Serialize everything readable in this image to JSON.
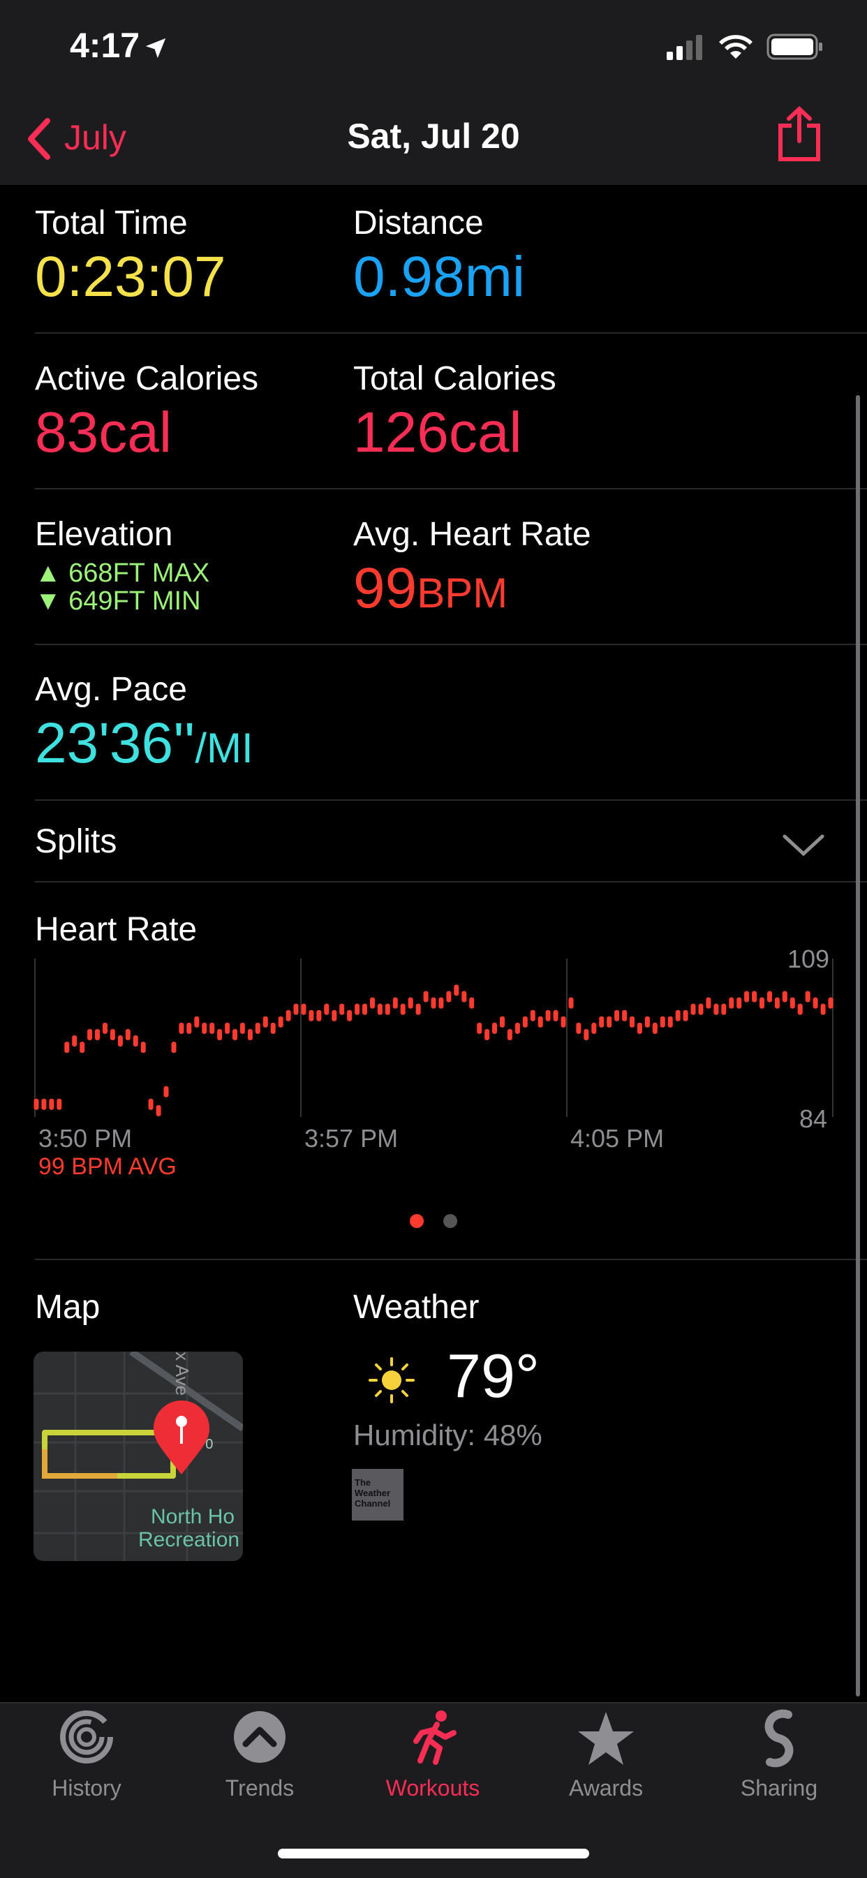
{
  "status": {
    "time": "4:17"
  },
  "nav": {
    "back_label": "July",
    "title": "Sat, Jul 20"
  },
  "metrics": {
    "total_time": {
      "label": "Total Time",
      "value": "0:23:07"
    },
    "distance": {
      "label": "Distance",
      "value": "0.98mi"
    },
    "active_calories": {
      "label": "Active Calories",
      "value": "83cal"
    },
    "total_calories": {
      "label": "Total Calories",
      "value": "126cal"
    },
    "elevation": {
      "label": "Elevation",
      "max": "▲ 668FT MAX",
      "min": "▼ 649FT MIN"
    },
    "avg_heart_rate": {
      "label": "Avg. Heart Rate",
      "value": "99",
      "unit": "BPM"
    },
    "avg_pace": {
      "label": "Avg. Pace",
      "value": "23'36''",
      "unit": "/MI"
    }
  },
  "splits": {
    "label": "Splits"
  },
  "heart_rate": {
    "label": "Heart Rate",
    "y_max_label": "109",
    "y_min_label": "84",
    "x_labels": [
      "3:50 PM",
      "3:57 PM",
      "4:05 PM"
    ],
    "avg_label": "99 BPM AVG"
  },
  "chart_data": {
    "type": "scatter",
    "title": "Heart Rate",
    "ylim": [
      84,
      109
    ],
    "x_tick_labels": [
      "3:50 PM",
      "3:57 PM",
      "4:05 PM"
    ],
    "series": [
      {
        "values": [
          86,
          86,
          86,
          86,
          95,
          96,
          95,
          97,
          97,
          98,
          97,
          96,
          97,
          96,
          95,
          86,
          85,
          88,
          95,
          98,
          98,
          99,
          98,
          98,
          97,
          98,
          97,
          98,
          97,
          98,
          99,
          98,
          99,
          100,
          101,
          101,
          100,
          100,
          101,
          100,
          101,
          100,
          101,
          101,
          102,
          101,
          101,
          102,
          101,
          102,
          101,
          103,
          102,
          102,
          103,
          104,
          103,
          102,
          98,
          97,
          98,
          99,
          97,
          98,
          99,
          100,
          99,
          100,
          100,
          99,
          102,
          98,
          97,
          98,
          99,
          99,
          100,
          100,
          99,
          98,
          99,
          98,
          99,
          99,
          100,
          100,
          101,
          101,
          102,
          101,
          101,
          102,
          102,
          103,
          103,
          102,
          103,
          102,
          103,
          102,
          101,
          103,
          102,
          101,
          102
        ]
      }
    ],
    "color": "#ff3b2f"
  },
  "pager": {
    "active": 0,
    "count": 2
  },
  "map": {
    "label": "Map",
    "street_label": "x Ave",
    "area_label_1": "North Ho",
    "area_label_2": "Recreation",
    "route_badge": "170"
  },
  "weather": {
    "label": "Weather",
    "temperature": "79°",
    "humidity": "Humidity: 48%",
    "logo_text": "The Weather Channel"
  },
  "tabs": [
    {
      "label": "History",
      "icon": "history-rings-icon",
      "active": false
    },
    {
      "label": "Trends",
      "icon": "trends-chevron-icon",
      "active": false
    },
    {
      "label": "Workouts",
      "icon": "running-figure-icon",
      "active": true
    },
    {
      "label": "Awards",
      "icon": "awards-star-icon",
      "active": false
    },
    {
      "label": "Sharing",
      "icon": "sharing-icon",
      "active": false
    }
  ]
}
